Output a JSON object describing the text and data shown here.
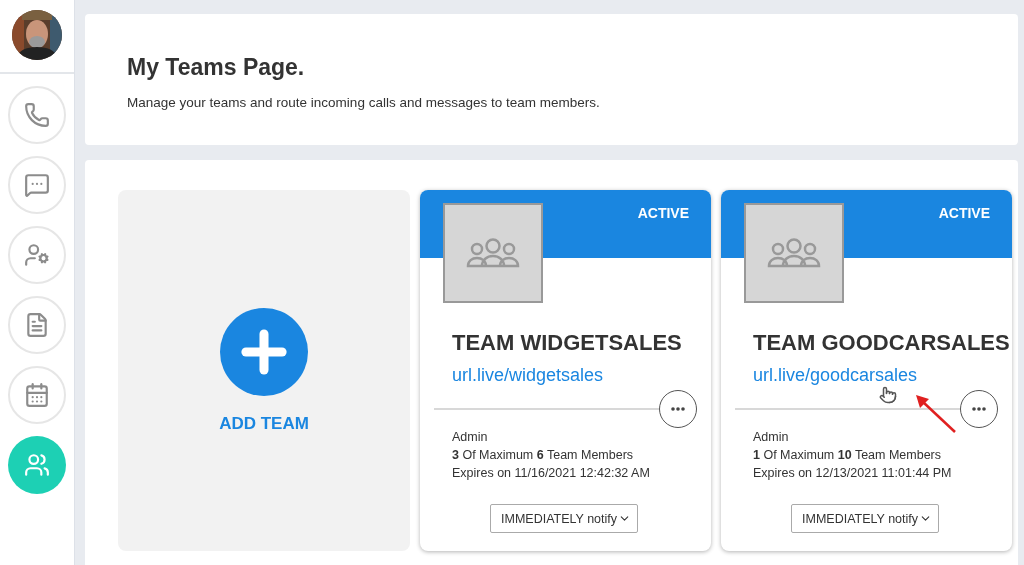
{
  "sidebar": {
    "items": [
      {
        "kind": "phone",
        "selected": false
      },
      {
        "kind": "messages",
        "selected": false
      },
      {
        "kind": "agent",
        "selected": false
      },
      {
        "kind": "document",
        "selected": false
      },
      {
        "kind": "calendar",
        "selected": false
      },
      {
        "kind": "teams",
        "selected": true
      }
    ]
  },
  "header": {
    "title": "My Teams Page.",
    "subtitle": "Manage your teams and route incoming calls and messages to team members."
  },
  "add_team": {
    "label": "ADD TEAM"
  },
  "teams": [
    {
      "status": "ACTIVE",
      "name": "TEAM WIDGETSALES",
      "url": "url.live/widgetsales",
      "role": "Admin",
      "members": "**3** Of Maximum **6** Team Members",
      "expires": "Expires on 11/16/2021 12:42:32 AM",
      "notify": "IMMEDIATELY notify"
    },
    {
      "status": "ACTIVE",
      "name": "TEAM GOODCARSALES",
      "url": "url.live/goodcarsales",
      "role": "Admin",
      "members": "**1** Of Maximum **10** Team Members",
      "expires": "Expires on 12/13/2021 11:01:44 PM",
      "notify": "IMMEDIATELY notify"
    }
  ]
}
